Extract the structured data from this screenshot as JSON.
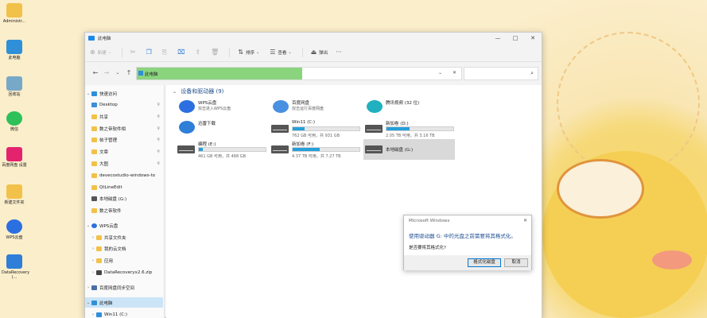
{
  "desktop": {
    "icons": [
      {
        "label": "Administr...",
        "color": "#f2c14a"
      },
      {
        "label": "此电脑",
        "color": "#2f8fd8"
      },
      {
        "label": "回收站",
        "color": "#78a8c8"
      },
      {
        "label": "微信",
        "color": "#2ec05a"
      },
      {
        "label": "百度网盘 设置",
        "color": "#e4236f"
      },
      {
        "label": "新建文件夹",
        "color": "#f2c14a"
      },
      {
        "label": "WPS云盘",
        "color": "#2c6fe0"
      },
      {
        "label": "DataRecovery (...",
        "color": "#2f7ed8"
      }
    ]
  },
  "window": {
    "title": "此电脑",
    "controls": {
      "minimize": "—",
      "maximize": "□",
      "close": "✕"
    }
  },
  "toolbar": {
    "new_label": "新建",
    "sort_label": "排序",
    "view_label": "查看",
    "eject_label": "弹出",
    "more_label": "···"
  },
  "address": {
    "back": "←",
    "forward": "→",
    "recent": "⌄",
    "up": "↑",
    "path": "此电脑",
    "dropdown": "⌄",
    "clear": "✕",
    "search_icon": "⌕"
  },
  "nav": {
    "items": [
      {
        "label": "快速访问",
        "chev": "⌄",
        "icon_color": "#2f8fd8",
        "pin": ""
      },
      {
        "label": "Desktop",
        "chev": "",
        "icon_color": "#3c8fd8",
        "pin": "📌"
      },
      {
        "label": "共享",
        "chev": "",
        "icon_color": "#f2c14a",
        "pin": "📌"
      },
      {
        "label": "数之帝软件相",
        "chev": "",
        "icon_color": "#f2c14a",
        "pin": "📌"
      },
      {
        "label": "帖子管理",
        "chev": "",
        "icon_color": "#f2c14a",
        "pin": "📌"
      },
      {
        "label": "文章",
        "chev": "",
        "icon_color": "#f2c14a",
        "pin": "📌"
      },
      {
        "label": "大图",
        "chev": "",
        "icon_color": "#f2c14a",
        "pin": "📌"
      },
      {
        "label": "devecostudio-windows-to",
        "chev": "",
        "icon_color": "#f2c14a",
        "pin": ""
      },
      {
        "label": "QtLineEdit",
        "chev": "",
        "icon_color": "#f2c14a",
        "pin": ""
      },
      {
        "label": "本地磁盘 (G:)",
        "chev": "",
        "icon_color": "#555555",
        "pin": ""
      },
      {
        "label": "数之帝软件",
        "chev": "",
        "icon_color": "#f2c14a",
        "pin": ""
      },
      {
        "label": "WPS云盘",
        "chev": "⌄",
        "icon_color": "#2c6fe0",
        "pin": ""
      },
      {
        "label": "共享文件夹",
        "chev": "›",
        "icon_color": "#f2c14a",
        "pin": ""
      },
      {
        "label": "我的云文档",
        "chev": "›",
        "icon_color": "#f2c14a",
        "pin": ""
      },
      {
        "label": "应用",
        "chev": "›",
        "icon_color": "#f2c14a",
        "pin": ""
      },
      {
        "label": "DataRecoveryx2.6.zip",
        "chev": "›",
        "icon_color": "#444444",
        "pin": ""
      },
      {
        "label": "百度网盘同步空间",
        "chev": "›",
        "icon_color": "#4a6fa5",
        "pin": ""
      },
      {
        "label": "此电脑",
        "chev": "⌄",
        "icon_color": "#2f8fd8",
        "pin": ""
      },
      {
        "label": "Win11 (C:)",
        "chev": "›",
        "icon_color": "#2f8fd8",
        "pin": ""
      }
    ]
  },
  "content": {
    "group_chev": "⌄",
    "group_title": "设备和驱动器 (9)",
    "tiles": [
      {
        "name": "WPS云盘",
        "sub": "双击进入WPS云盘",
        "type": "app",
        "color": "#2c6fe0"
      },
      {
        "name": "百度网盘",
        "sub": "双击运行百度网盘",
        "type": "app",
        "color": "#4a90e2"
      },
      {
        "name": "腾讯视频 (32 位)",
        "sub": "",
        "type": "app",
        "color": "#20b0c0"
      },
      {
        "name": "迅雷下载",
        "sub": "",
        "type": "app",
        "color": "#2f7ed8"
      },
      {
        "name": "Win11 (C:)",
        "free": "762 GB 可用，共 931 GB",
        "used_pct": 18,
        "type": "drive"
      },
      {
        "name": "新加卷 (D:)",
        "free": "2.05 TB 可用，共 3.16 TB",
        "used_pct": 35,
        "type": "drive"
      },
      {
        "name": "编程 (E:)",
        "free": "461 GB 可用，共 488 GB",
        "used_pct": 6,
        "type": "drive"
      },
      {
        "name": "新加卷 (F:)",
        "free": "4.37 TB 可用，共 7.27 TB",
        "used_pct": 40,
        "type": "drive"
      },
      {
        "name": "本地磁盘 (G:)",
        "free": "",
        "used_pct": null,
        "type": "drive-selected"
      }
    ]
  },
  "dialog": {
    "title": "Microsoft Windows",
    "close": "✕",
    "message": "使用驱动器 G: 中的光盘之前需要将其格式化。",
    "question": "是否要将其格式化?",
    "format_button": "格式化磁盘",
    "cancel_button": "取消"
  }
}
